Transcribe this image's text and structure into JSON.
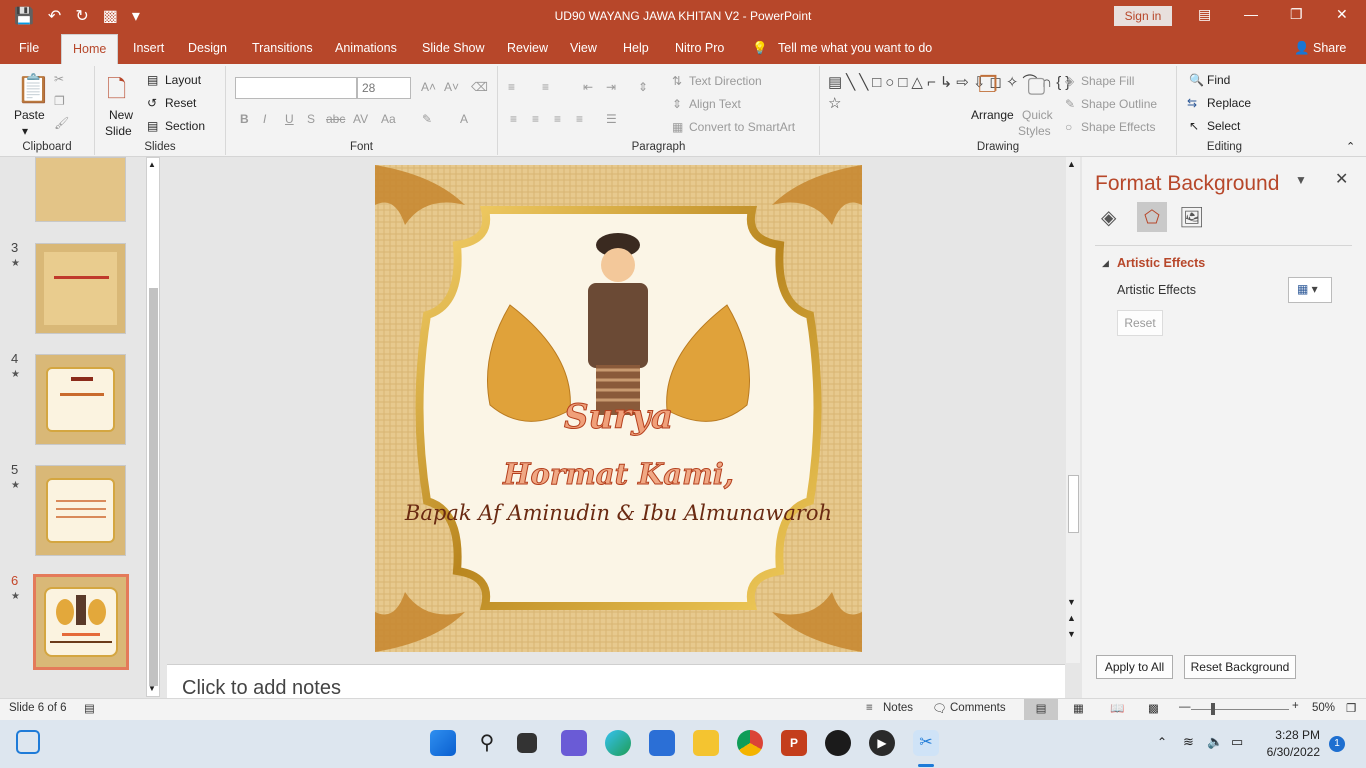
{
  "window": {
    "title": "UD90 WAYANG JAWA KHITAN V2  -  PowerPoint",
    "signin": "Sign in"
  },
  "tabs": [
    "File",
    "Home",
    "Insert",
    "Design",
    "Transitions",
    "Animations",
    "Slide Show",
    "Review",
    "View",
    "Help",
    "Nitro Pro"
  ],
  "tell_me": "Tell me what you want to do",
  "share": "Share",
  "ribbon": {
    "clipboard": {
      "paste": "Paste",
      "label": "Clipboard"
    },
    "slides": {
      "new_slide_1": "New",
      "new_slide_2": "Slide",
      "layout": "Layout",
      "reset": "Reset",
      "section": "Section",
      "label": "Slides"
    },
    "font": {
      "size": "28",
      "label": "Font"
    },
    "paragraph": {
      "text_direction": "Text Direction",
      "align_text": "Align Text",
      "convert_smartart": "Convert to SmartArt",
      "label": "Paragraph"
    },
    "drawing": {
      "arrange": "Arrange",
      "quick_1": "Quick",
      "quick_2": "Styles",
      "shape_fill": "Shape Fill",
      "shape_outline": "Shape Outline",
      "shape_effects": "Shape Effects",
      "label": "Drawing"
    },
    "editing": {
      "find": "Find",
      "replace": "Replace",
      "select": "Select",
      "label": "Editing"
    }
  },
  "slides_panel": [
    {
      "num": "3"
    },
    {
      "num": "4"
    },
    {
      "num": "5"
    },
    {
      "num": "6"
    }
  ],
  "slide": {
    "name": "Surya",
    "heading": "Hormat Kami,",
    "subheading": "Bapak Af Aminudin & Ibu Almunawaroh"
  },
  "notes_placeholder": "Click to add notes",
  "format_background": {
    "title": "Format Background",
    "section": "Artistic Effects",
    "row_label": "Artistic Effects",
    "reset": "Reset",
    "apply_all": "Apply to All",
    "reset_background": "Reset Background"
  },
  "status": {
    "slide_info": "Slide 6 of 6",
    "notes": "Notes",
    "comments": "Comments",
    "zoom": "50%"
  },
  "clock": {
    "time": "3:28 PM",
    "date": "6/30/2022",
    "badge": "1"
  }
}
